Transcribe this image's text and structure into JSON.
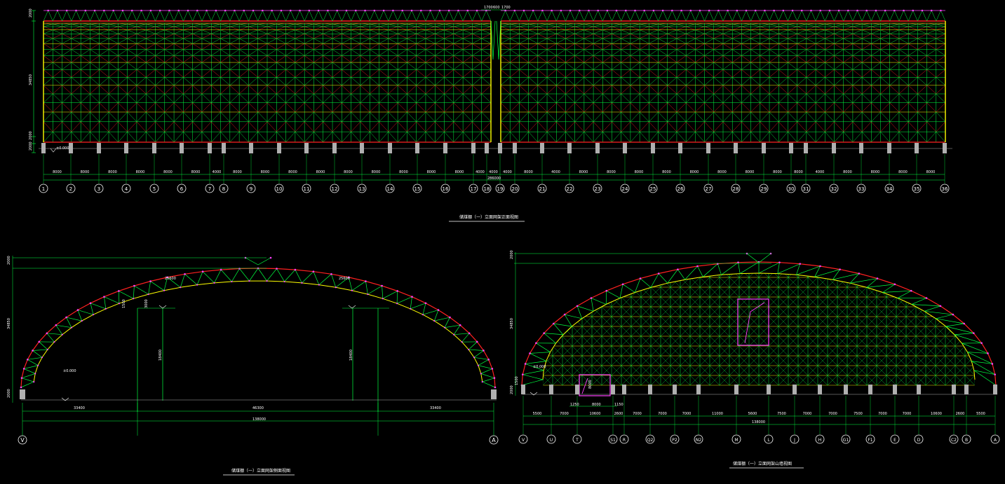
{
  "drawing": {
    "colors": {
      "background": "#000000",
      "chord": "#ff2020",
      "web": "#00ff40",
      "lower": "#ffff00",
      "node": "#ff40ff",
      "dimension": "#00ff40",
      "support": "#b0b0b0",
      "caption_underline": "#ffffff"
    },
    "elevation": {
      "overall_dimension": "286000",
      "top_dimensions": [
        "1700",
        "600",
        "1700"
      ],
      "height_dimension": "34850",
      "left_small_dims": [
        "2000",
        "2000"
      ],
      "top_left_dim": "2000",
      "level_label": "±0.000",
      "bay_dimensions": [
        "8000",
        "8000",
        "8000",
        "8000",
        "8000",
        "8000",
        "4000",
        "8000",
        "8000",
        "8000",
        "8000",
        "8000",
        "8000",
        "8000",
        "8000",
        "8000",
        "4000",
        "4000",
        "4000",
        "8000",
        "4000",
        "8000",
        "8000",
        "8000",
        "8000",
        "8000",
        "8000",
        "8000",
        "8000",
        "8000",
        "4000",
        "8000",
        "8000",
        "8000",
        "8000",
        "8000"
      ],
      "axis_labels": [
        "1",
        "2",
        "3",
        "4",
        "5",
        "6",
        "7",
        "8",
        "9",
        "10",
        "11",
        "12",
        "13",
        "14",
        "15",
        "16",
        "17",
        "18",
        "19",
        "20",
        "21",
        "22",
        "23",
        "24",
        "25",
        "26",
        "27",
        "28",
        "29",
        "30",
        "31",
        "32",
        "33",
        "34",
        "35",
        "36"
      ],
      "caption": "储煤棚（一）立面网架正面视图"
    },
    "section": {
      "top_dimension": "2000",
      "height_dimension": "34850",
      "base_dimension": "2000",
      "arc_label_left": "25600",
      "arc_label_right": "25600",
      "col_height_left": "18400",
      "col_height_right": "18400",
      "small_dim_a": "1500",
      "small_dim_b": "3000",
      "level_label": "±0.000",
      "bottom_dims": [
        "33400",
        "46300",
        "33400"
      ],
      "overall_dimension": "138000",
      "axis_left": "V",
      "axis_right": "A",
      "caption": "储煤棚（一）立面网架侧面视图"
    },
    "end_elevation": {
      "top_dimension": "2000",
      "height_dimension": "34850",
      "base_dims": [
        "2000",
        "1500"
      ],
      "level_label": "±0.000",
      "door_dim": "8000",
      "door_sub_dims": [
        "1250",
        "8000",
        "1150"
      ],
      "bay_dims": [
        "5500",
        "7000",
        "10600",
        "2600",
        "7000",
        "7000",
        "7000",
        "11000",
        "5600",
        "7500",
        "7000",
        "7000",
        "7500",
        "7000",
        "7000",
        "10600",
        "2600",
        "5500"
      ],
      "overall_dimension": "138000",
      "axis_labels": [
        "V",
        "U",
        "T",
        "S1",
        "R",
        "Q2",
        "P2",
        "N2",
        "M",
        "L",
        "J",
        "H",
        "G1",
        "F1",
        "E",
        "D",
        "C2",
        "B",
        "A"
      ],
      "caption": "储煤棚（一）立面网架山墙视图"
    }
  }
}
